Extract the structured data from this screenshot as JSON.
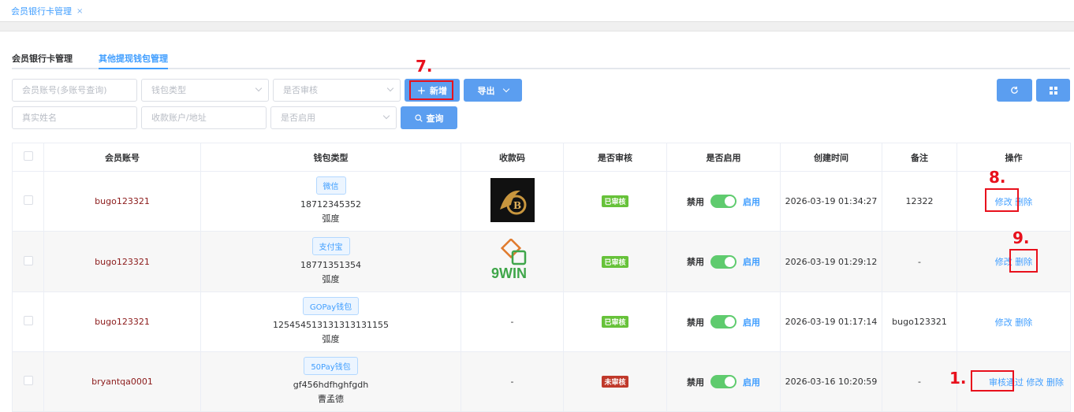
{
  "tabbar": {
    "tab_label": "会员银行卡管理",
    "close_glyph": "×"
  },
  "subtabs": [
    "会员银行卡管理",
    "其他提现钱包管理"
  ],
  "filters": {
    "account_placeholder": "会员账号(多账号查询)",
    "wallet_type_placeholder": "钱包类型",
    "audit_placeholder": "是否审核",
    "realname_placeholder": "真实姓名",
    "address_placeholder": "收款账户/地址",
    "enabled_placeholder": "是否启用"
  },
  "buttons": {
    "add": "新增",
    "export": "导出",
    "query": "查询"
  },
  "annotations": {
    "a7": "7.",
    "a8": "8.",
    "a9": "9.",
    "a1": "1."
  },
  "table": {
    "headers": [
      "会员账号",
      "钱包类型",
      "收款码",
      "是否审核",
      "是否启用",
      "创建时间",
      "备注",
      "操作"
    ],
    "rows": [
      {
        "account": "bugo123321",
        "wallet_tag": "微信",
        "wallet_no": "18712345352",
        "wallet_name": "弧度",
        "qr": "logo-b",
        "audit": "已审核",
        "disable": "禁用",
        "enable": "启用",
        "created": "2026-03-19 01:34:27",
        "remark": "12322",
        "ops": [
          "修改",
          "删除"
        ]
      },
      {
        "account": "bugo123321",
        "wallet_tag": "支付宝",
        "wallet_no": "18771351354",
        "wallet_name": "弧度",
        "qr": "logo-9win",
        "qr_text": "9WIN",
        "audit": "已审核",
        "disable": "禁用",
        "enable": "启用",
        "created": "2026-03-19 01:29:12",
        "remark": "-",
        "ops": [
          "修改",
          "删除"
        ]
      },
      {
        "account": "bugo123321",
        "wallet_tag": "GOPay钱包",
        "wallet_no": "125454513131313131155",
        "wallet_name": "弧度",
        "qr_text": "-",
        "audit": "已审核",
        "disable": "禁用",
        "enable": "启用",
        "created": "2026-03-19 01:17:14",
        "remark": "bugo123321",
        "ops": [
          "修改",
          "删除"
        ]
      },
      {
        "account": "bryantqa0001",
        "wallet_tag": "50Pay钱包",
        "wallet_no": "gf456hdfhghfgdh",
        "wallet_name": "曹孟德",
        "qr_text": "-",
        "audit": "未审核",
        "disable": "禁用",
        "enable": "启用",
        "created": "2026-03-16 10:20:59",
        "remark": "-",
        "ops": [
          "审核通过",
          "修改",
          "删除"
        ]
      }
    ]
  },
  "colors": {
    "primary": "#409eff",
    "button": "#5b9ef0",
    "approved": "#67c23a",
    "unapproved": "#c0392b",
    "switch_on": "#5fcb6e",
    "annotation": "#e8101c"
  }
}
